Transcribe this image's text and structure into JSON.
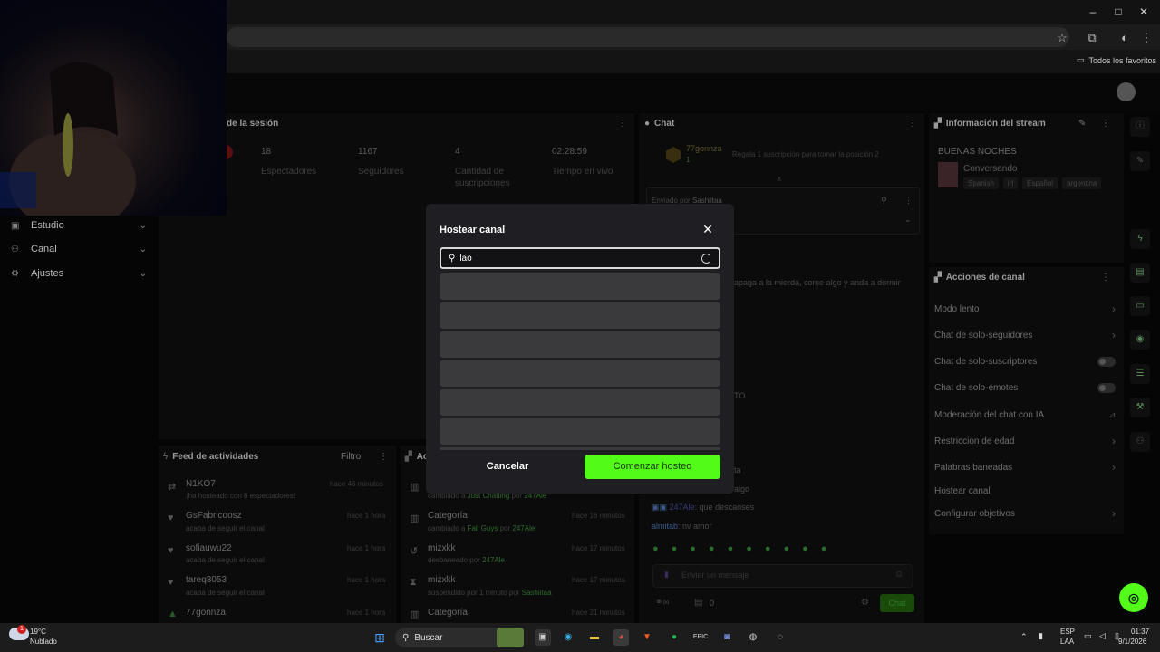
{
  "browser": {
    "window_controls": {
      "minimize": "–",
      "maximize": "□",
      "close": "✕"
    },
    "bookmarks_folder_label": "Todos los favoritos"
  },
  "nav": {
    "items": [
      {
        "label": "Estudio",
        "icon": "monitor-icon"
      },
      {
        "label": "Canal",
        "icon": "users-icon"
      },
      {
        "label": "Ajustes",
        "icon": "gear-icon"
      }
    ]
  },
  "session": {
    "title": "de la sesión",
    "stats": [
      {
        "value": "18",
        "label": "Espectadores"
      },
      {
        "value": "1167",
        "label": "Seguidores"
      },
      {
        "value": "4",
        "label": "Cantidad de suscripciones"
      },
      {
        "value": "02:28:59",
        "label": "Tiempo en vivo"
      }
    ]
  },
  "chat": {
    "title": "Chat",
    "top_user": "77gonnza",
    "top_count": "1",
    "gift_prompt": "Regala 1 suscripción para tomar la posición 2",
    "pinned_by_label": "Enviado por",
    "pinned_by_user": "Sashiitaa",
    "msg1": "apaga a la mierda, come algo y anda a dormir",
    "msg2": "TO",
    "msg3": "ta",
    "msg4": "algo",
    "msg5_user": "247Ale",
    "msg5_text": ": que descanses",
    "msg6_user": "almitab",
    "msg6_text": ": nv amor",
    "input_placeholder": "Enviar un mensaje",
    "points": "0",
    "send_label": "Chat"
  },
  "stream_info": {
    "title": "Información del stream",
    "stream_title": "BUENAS NOCHES",
    "category": "Conversando",
    "tags": [
      "Spanish",
      "irl",
      "Español",
      "argentina"
    ]
  },
  "channel_actions": {
    "title": "Acciones de canal",
    "items": [
      {
        "label": "Modo lento",
        "control": "chevron"
      },
      {
        "label": "Chat de solo-seguidores",
        "control": "chevron"
      },
      {
        "label": "Chat de solo-suscriptores",
        "control": "toggle"
      },
      {
        "label": "Chat de solo-emotes",
        "control": "toggle"
      },
      {
        "label": "Moderación del chat con IA",
        "control": "chart"
      },
      {
        "label": "Restricción de edad",
        "control": "chevron"
      },
      {
        "label": "Palabras baneadas",
        "control": "chevron"
      },
      {
        "label": "Hostear canal",
        "control": "none"
      },
      {
        "label": "Configurar objetivos",
        "control": "chevron"
      }
    ]
  },
  "feed": {
    "title": "Feed de actividades",
    "filter_label": "Filtro",
    "items": [
      {
        "name": "N1KO7",
        "sub": "¡ha hosteado con 8 espectadores!",
        "time": "hace 46 minutos",
        "icon": "host-icon"
      },
      {
        "name": "GsFabricoosz",
        "sub": "acaba de seguir el canal",
        "time": "hace 1 hora",
        "icon": "heart-icon"
      },
      {
        "name": "sofiauwu22",
        "sub": "acaba de seguir el canal",
        "time": "hace 1 hora",
        "icon": "heart-icon"
      },
      {
        "name": "tareq3053",
        "sub": "acaba de seguir el canal",
        "time": "hace 1 hora",
        "icon": "heart-icon"
      },
      {
        "name": "77gonnza",
        "sub": "",
        "time": "hace 1 hora",
        "icon": "sub-icon"
      }
    ]
  },
  "mod_log": {
    "title": "Ac",
    "items": [
      {
        "name": "",
        "sub_prefix": "cambiado a ",
        "sub_hl": "Just Chatting",
        "sub_mid": " por ",
        "sub_user": "247Ale",
        "time": ""
      },
      {
        "name": "Categoría",
        "sub_prefix": "cambiado a ",
        "sub_hl": "Fall Guys",
        "sub_mid": " por ",
        "sub_user": "247Ale",
        "time": "hace 16 minutos"
      },
      {
        "name": "mizxkk",
        "sub_prefix": "desbaneado por ",
        "sub_hl": "",
        "sub_mid": "",
        "sub_user": "247Ale",
        "time": "hace 17 minutos"
      },
      {
        "name": "mizxkk",
        "sub_prefix": "suspendido por 1 minuto por ",
        "sub_hl": "",
        "sub_mid": "",
        "sub_user": "Sashiitaa",
        "time": "hace 17 minutos"
      },
      {
        "name": "Categoría",
        "sub_prefix": "",
        "sub_hl": "",
        "sub_mid": "",
        "sub_user": "",
        "time": "hace 21 minutos"
      }
    ]
  },
  "modal": {
    "title": "Hostear canal",
    "search_value": "lao",
    "cancel_label": "Cancelar",
    "start_label": "Comenzar hosteo",
    "accent": "#53fc18"
  },
  "taskbar": {
    "weather_temp": "19°C",
    "weather_desc": "Nublado",
    "weather_badge": "1",
    "search_label": "Buscar",
    "lang_top": "ESP",
    "lang_bottom": "LAA",
    "time": "01:37",
    "date": "9/1/2026"
  }
}
